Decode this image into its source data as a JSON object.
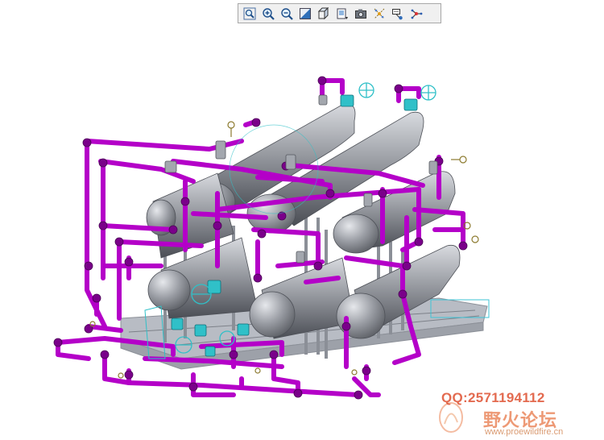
{
  "toolbar": {
    "buttons": [
      {
        "name": "refit-button",
        "icon": "refit-icon"
      },
      {
        "name": "zoom-in-button",
        "icon": "zoom-in-icon"
      },
      {
        "name": "zoom-out-button",
        "icon": "zoom-out-icon"
      },
      {
        "name": "repaint-button",
        "icon": "repaint-icon"
      },
      {
        "name": "display-style-button",
        "icon": "cube-icon"
      },
      {
        "name": "saved-views-button",
        "icon": "saved-views-icon"
      },
      {
        "name": "view-manager-button",
        "icon": "camera-icon"
      },
      {
        "name": "datum-display-button",
        "icon": "datum-planes-icon"
      },
      {
        "name": "annotation-display-button",
        "icon": "annotation-icon"
      },
      {
        "name": "spin-center-button",
        "icon": "spin-center-icon"
      }
    ]
  },
  "model": {
    "pipe_color": "#b400c8",
    "vessel_color": "#9c9ea4",
    "valve_color": "#30c0c8",
    "frame_color": "#b8bcc4"
  },
  "watermark": {
    "qq": "QQ:2571194112",
    "site_cn": "野火论坛",
    "url": "www.proewildfire.cn"
  }
}
